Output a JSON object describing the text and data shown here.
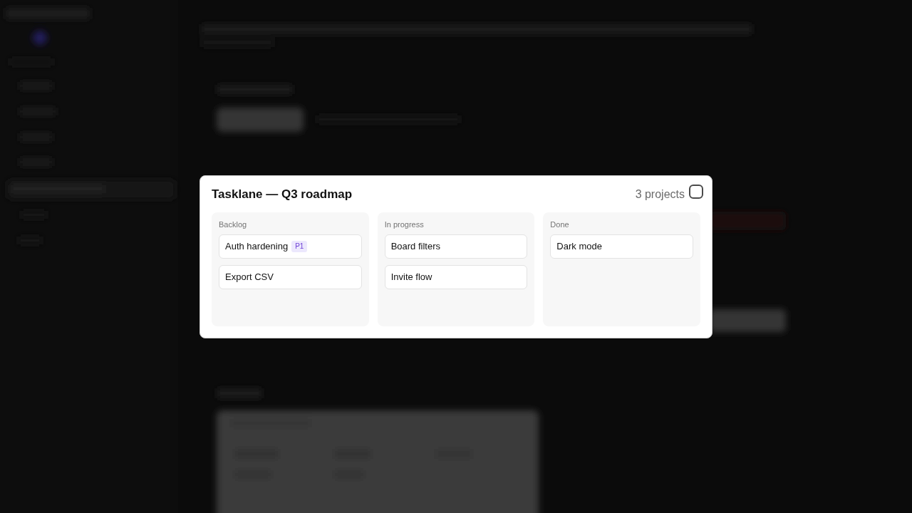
{
  "dialog": {
    "title": "Tasklane — Q3 roadmap",
    "count": "3 projects",
    "columns": [
      {
        "label": "Backlog",
        "cards": [
          {
            "title": "Auth hardening",
            "badge": "P1"
          },
          {
            "title": "Export CSV"
          }
        ]
      },
      {
        "label": "In progress",
        "cards": [
          {
            "title": "Board filters"
          },
          {
            "title": "Invite flow"
          }
        ]
      },
      {
        "label": "Done",
        "cards": [
          {
            "title": "Dark mode"
          }
        ]
      }
    ]
  }
}
